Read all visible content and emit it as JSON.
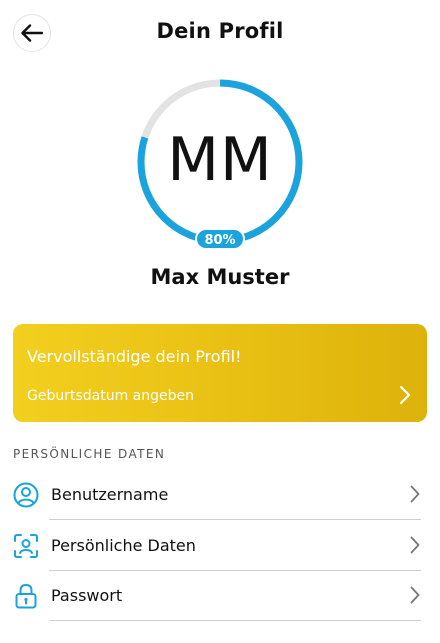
{
  "header": {
    "title": "Dein Profil",
    "back_icon": "arrow-left-icon"
  },
  "profile": {
    "initials": "MM",
    "completion_label": "80%",
    "completion_fraction": 0.8,
    "name": "Max Muster",
    "ring_color": "#1aa3dd",
    "ring_track_color": "#e3e3e3"
  },
  "promo": {
    "title": "Vervollständige dein Profil!",
    "action": "Geburtsdatum angeben",
    "color": "#e7be12"
  },
  "personal_data": {
    "heading": "PERSÖNLICHE DATEN",
    "items": [
      {
        "label": "Benutzername",
        "icon": "user-circle-icon"
      },
      {
        "label": "Persönliche Daten",
        "icon": "face-id-icon"
      },
      {
        "label": "Passwort",
        "icon": "lock-icon"
      }
    ]
  },
  "accent_color": "#1aa3dd"
}
